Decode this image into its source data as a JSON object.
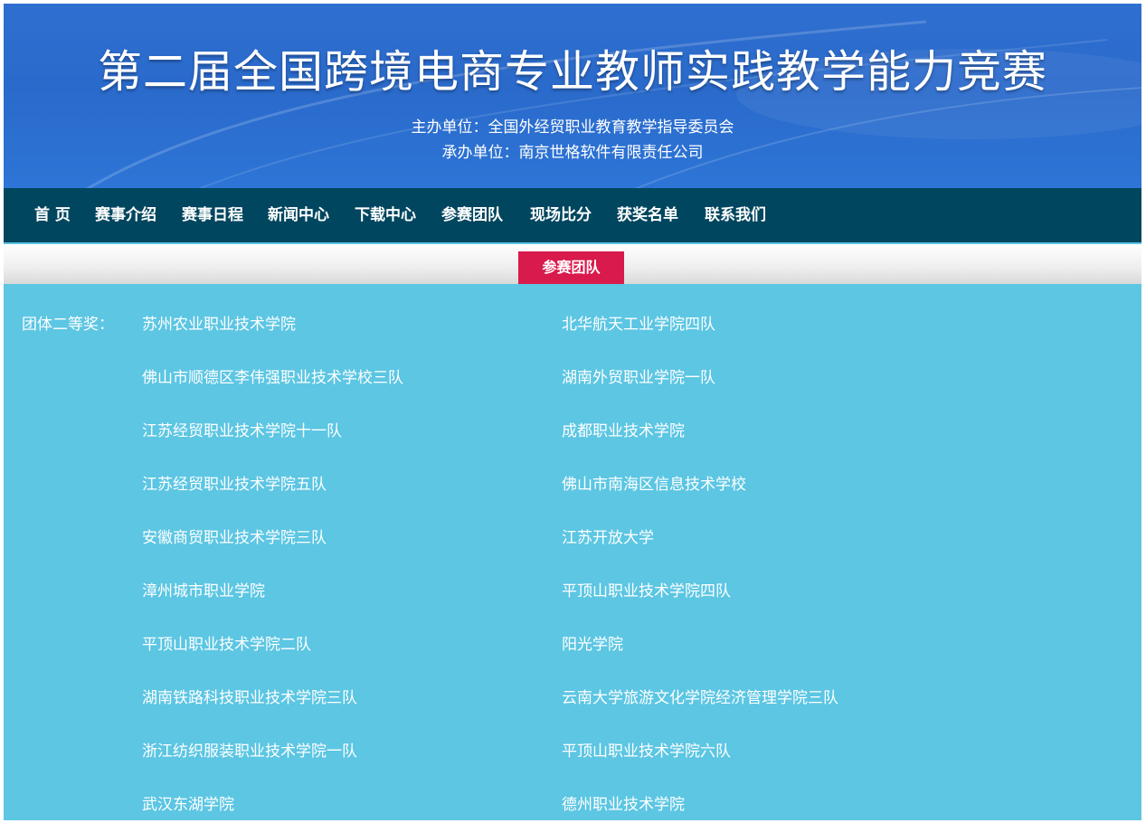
{
  "header": {
    "title": "第二届全国跨境电商专业教师实践教学能力竞赛",
    "organizer": "主办单位：全国外经贸职业教育教学指导委员会",
    "host": "承办单位：南京世格软件有限责任公司"
  },
  "nav": {
    "items": [
      {
        "label": "首 页"
      },
      {
        "label": "赛事介绍"
      },
      {
        "label": "赛事日程"
      },
      {
        "label": "新闻中心"
      },
      {
        "label": "下载中心"
      },
      {
        "label": "参赛团队"
      },
      {
        "label": "现场比分"
      },
      {
        "label": "获奖名单"
      },
      {
        "label": "联系我们"
      }
    ]
  },
  "section": {
    "tab_label": "参赛团队"
  },
  "award": {
    "label": "团体二等奖：",
    "left": [
      "苏州农业职业技术学院",
      "佛山市顺德区李伟强职业技术学校三队",
      "江苏经贸职业技术学院十一队",
      "江苏经贸职业技术学院五队",
      "安徽商贸职业技术学院三队",
      "漳州城市职业学院",
      "平顶山职业技术学院二队",
      "湖南铁路科技职业技术学院三队",
      "浙江纺织服装职业技术学院一队",
      "武汉东湖学院"
    ],
    "right": [
      "北华航天工业学院四队",
      "湖南外贸职业学院一队",
      "成都职业技术学院",
      "佛山市南海区信息技术学校",
      "江苏开放大学",
      "平顶山职业技术学院四队",
      "阳光学院",
      "云南大学旅游文化学院经济管理学院三队",
      "平顶山职业技术学院六队",
      "德州职业技术学院"
    ]
  },
  "colors": {
    "banner": "#2f6fd0",
    "nav_bg": "#00465f",
    "tab_active": "#d91a4c",
    "content_bg": "#5cc6e3"
  }
}
